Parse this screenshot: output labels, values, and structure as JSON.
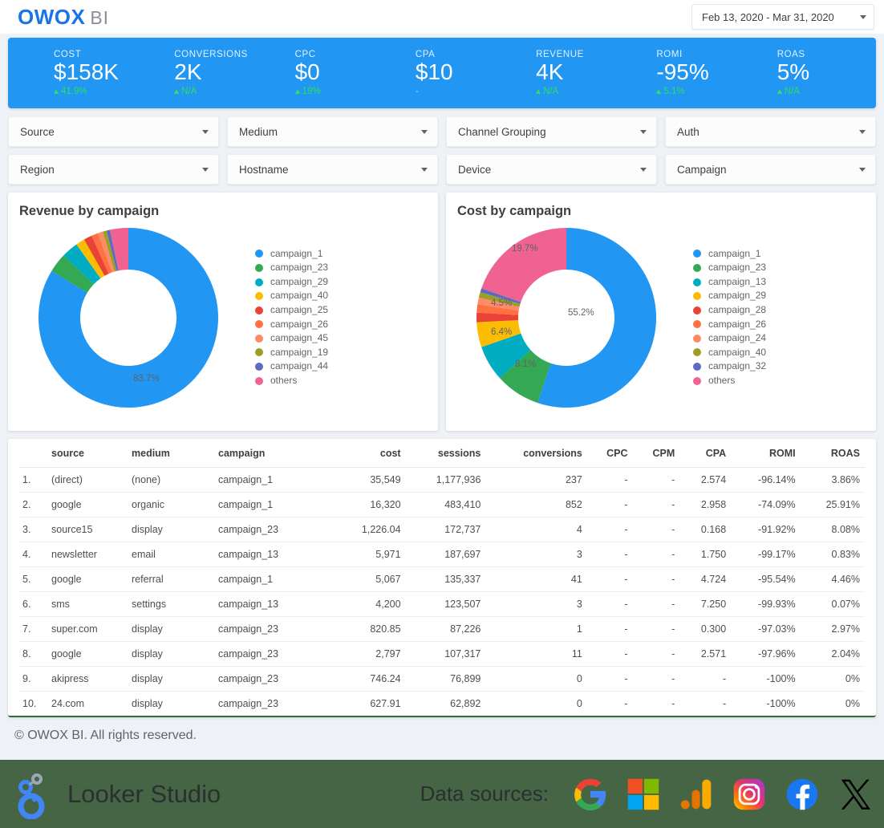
{
  "header": {
    "logo_main": "OWOX",
    "logo_sub": "BI",
    "date_range": "Feb 13, 2020 - Mar 31, 2020"
  },
  "kpis": [
    {
      "label": "COST",
      "value": "$158K",
      "delta": "41.9%",
      "delta_state": "up"
    },
    {
      "label": "CONVERSIONS",
      "value": "2K",
      "delta": "N/A",
      "delta_state": "up"
    },
    {
      "label": "CPC",
      "value": "$0",
      "delta": "19%",
      "delta_state": "up"
    },
    {
      "label": "CPA",
      "value": "$10",
      "delta": "-",
      "delta_state": "none"
    },
    {
      "label": "REVENUE",
      "value": "4K",
      "delta": "N/A",
      "delta_state": "up"
    },
    {
      "label": "ROMI",
      "value": "-95%",
      "delta": "5.1%",
      "delta_state": "up"
    },
    {
      "label": "ROAS",
      "value": "5%",
      "delta": "N/A",
      "delta_state": "up"
    }
  ],
  "filters": [
    {
      "label": "Source"
    },
    {
      "label": "Medium"
    },
    {
      "label": "Channel Grouping"
    },
    {
      "label": "Auth"
    },
    {
      "label": "Region"
    },
    {
      "label": "Hostname"
    },
    {
      "label": "Device"
    },
    {
      "label": "Campaign"
    }
  ],
  "chart_data": [
    {
      "type": "pie",
      "title": "Revenue by campaign",
      "categories": [
        "campaign_1",
        "campaign_23",
        "campaign_29",
        "campaign_40",
        "campaign_25",
        "campaign_26",
        "campaign_45",
        "campaign_19",
        "campaign_44",
        "others"
      ],
      "values": [
        83.7,
        3.5,
        3.0,
        1.6,
        1.5,
        1.2,
        0.9,
        0.7,
        0.6,
        3.3
      ],
      "colors": [
        "#2196f3",
        "#34a853",
        "#00acc1",
        "#fbbc04",
        "#ea4335",
        "#ff7043",
        "#ff8a65",
        "#9e9d24",
        "#5c6bc0",
        "#f06292"
      ],
      "visible_labels": [
        {
          "text": "83.7%"
        }
      ],
      "legend_position": "right",
      "donut": true
    },
    {
      "type": "pie",
      "title": "Cost by campaign",
      "categories": [
        "campaign_1",
        "campaign_23",
        "campaign_13",
        "campaign_29",
        "campaign_28",
        "campaign_26",
        "campaign_24",
        "campaign_40",
        "campaign_32",
        "others"
      ],
      "values": [
        55.2,
        8.1,
        6.4,
        4.5,
        1.7,
        1.5,
        1.2,
        1.0,
        0.7,
        19.7
      ],
      "colors": [
        "#2196f3",
        "#34a853",
        "#00acc1",
        "#fbbc04",
        "#ea4335",
        "#ff7043",
        "#ff8a65",
        "#9e9d24",
        "#5c6bc0",
        "#f06292"
      ],
      "visible_labels": [
        {
          "text": "55.2%"
        },
        {
          "text": "8.1%"
        },
        {
          "text": "6.4%"
        },
        {
          "text": "4.5%"
        },
        {
          "text": "19.7%"
        }
      ],
      "legend_position": "right",
      "donut": true
    }
  ],
  "table": {
    "columns": [
      "",
      "source",
      "medium",
      "campaign",
      "cost",
      "sessions",
      "conversions",
      "CPC",
      "CPM",
      "CPA",
      "ROMI",
      "ROAS"
    ],
    "rows": [
      {
        "idx": "1.",
        "source": "(direct)",
        "medium": "(none)",
        "campaign": "campaign_1",
        "cost": "35,549",
        "sessions": "1,177,936",
        "conversions": "237",
        "cpc": "-",
        "cpm": "-",
        "cpa": "2.574",
        "romi": "-96.14%",
        "roas": "3.86%"
      },
      {
        "idx": "2.",
        "source": "google",
        "medium": "organic",
        "campaign": "campaign_1",
        "cost": "16,320",
        "sessions": "483,410",
        "conversions": "852",
        "cpc": "-",
        "cpm": "-",
        "cpa": "2.958",
        "romi": "-74.09%",
        "roas": "25.91%"
      },
      {
        "idx": "3.",
        "source": "source15",
        "medium": "display",
        "campaign": "campaign_23",
        "cost": "1,226.04",
        "sessions": "172,737",
        "conversions": "4",
        "cpc": "-",
        "cpm": "-",
        "cpa": "0.168",
        "romi": "-91.92%",
        "roas": "8.08%"
      },
      {
        "idx": "4.",
        "source": "newsletter",
        "medium": "email",
        "campaign": "campaign_13",
        "cost": "5,971",
        "sessions": "187,697",
        "conversions": "3",
        "cpc": "-",
        "cpm": "-",
        "cpa": "1.750",
        "romi": "-99.17%",
        "roas": "0.83%"
      },
      {
        "idx": "5.",
        "source": "google",
        "medium": "referral",
        "campaign": "campaign_1",
        "cost": "5,067",
        "sessions": "135,337",
        "conversions": "41",
        "cpc": "-",
        "cpm": "-",
        "cpa": "4.724",
        "romi": "-95.54%",
        "roas": "4.46%"
      },
      {
        "idx": "6.",
        "source": "sms",
        "medium": "settings",
        "campaign": "campaign_13",
        "cost": "4,200",
        "sessions": "123,507",
        "conversions": "3",
        "cpc": "-",
        "cpm": "-",
        "cpa": "7.250",
        "romi": "-99.93%",
        "roas": "0.07%"
      },
      {
        "idx": "7.",
        "source": "super.com",
        "medium": "display",
        "campaign": "campaign_23",
        "cost": "820.85",
        "sessions": "87,226",
        "conversions": "1",
        "cpc": "-",
        "cpm": "-",
        "cpa": "0.300",
        "romi": "-97.03%",
        "roas": "2.97%"
      },
      {
        "idx": "8.",
        "source": "google",
        "medium": "display",
        "campaign": "campaign_23",
        "cost": "2,797",
        "sessions": "107,317",
        "conversions": "11",
        "cpc": "-",
        "cpm": "-",
        "cpa": "2.571",
        "romi": "-97.96%",
        "roas": "2.04%"
      },
      {
        "idx": "9.",
        "source": "akipress",
        "medium": "display",
        "campaign": "campaign_23",
        "cost": "746.24",
        "sessions": "76,899",
        "conversions": "0",
        "cpc": "-",
        "cpm": "-",
        "cpa": "-",
        "romi": "-100%",
        "roas": "0%"
      },
      {
        "idx": "10.",
        "source": "24.com",
        "medium": "display",
        "campaign": "campaign_23",
        "cost": "627.91",
        "sessions": "62,892",
        "conversions": "0",
        "cpc": "-",
        "cpm": "-",
        "cpa": "-",
        "romi": "-100%",
        "roas": "0%"
      }
    ]
  },
  "copyright": "© OWOX BI. All rights reserved.",
  "footer": {
    "looker_label": "Looker Studio",
    "data_sources_label": "Data sources:",
    "data_source_icons": [
      "google-icon",
      "microsoft-icon",
      "google-analytics-icon",
      "instagram-icon",
      "facebook-icon",
      "x-twitter-icon"
    ]
  }
}
